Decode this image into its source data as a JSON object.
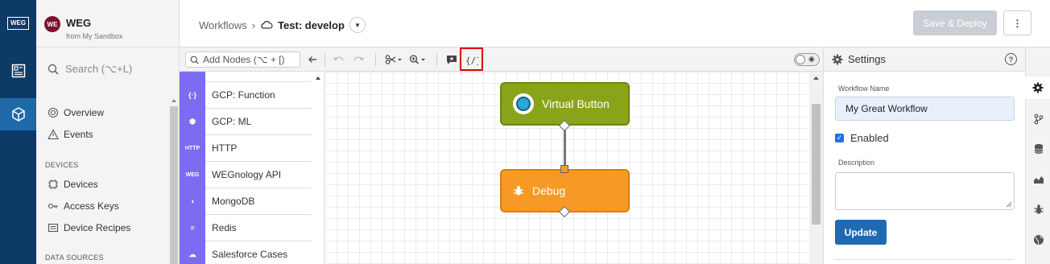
{
  "rail": {
    "logo": "WEG",
    "items": [
      {
        "icon": "dashboard-icon"
      },
      {
        "icon": "cube-icon",
        "active": true
      }
    ]
  },
  "sidebar": {
    "app_avatar": "WE",
    "app_name": "WEG",
    "app_sub": "from My Sandbox",
    "search_placeholder": "Search (⌥+L)",
    "items": [
      {
        "label": "Overview",
        "icon": "overview-icon"
      },
      {
        "label": "Events",
        "icon": "events-icon"
      }
    ],
    "section_devices": "DEVICES",
    "device_items": [
      {
        "label": "Devices",
        "icon": "chip-icon"
      },
      {
        "label": "Access Keys",
        "icon": "key-icon"
      },
      {
        "label": "Device Recipes",
        "icon": "recipe-icon"
      }
    ],
    "section_data": "DATA SOURCES"
  },
  "header": {
    "crumb_root": "Workflows",
    "crumb_sep": "›",
    "crumb_current": "Test: develop",
    "save_label": "Save & Deploy",
    "more_label": "⋮"
  },
  "toolbar": {
    "add_nodes_placeholder": "Add Nodes (⌥ + [)"
  },
  "palette": {
    "items": [
      {
        "label": "GCP: Function",
        "icon_text": "{·}"
      },
      {
        "label": "GCP: ML",
        "icon_text": "⬢"
      },
      {
        "label": "HTTP",
        "icon_text": "HTTP"
      },
      {
        "label": "WEGnology API",
        "icon_text": "WEG"
      },
      {
        "label": "MongoDB",
        "icon_text": "◖"
      },
      {
        "label": "Redis",
        "icon_text": "≡"
      },
      {
        "label": "Salesforce Cases",
        "icon_text": "☁"
      }
    ]
  },
  "canvas": {
    "nodes": [
      {
        "label": "Virtual Button",
        "color": "#8aa41a"
      },
      {
        "label": "Debug",
        "color": "#f79a25"
      }
    ]
  },
  "settings": {
    "title": "Settings",
    "name_label": "Workflow Name",
    "name_value": "My Great Workflow",
    "enabled_label": "Enabled",
    "description_label": "Description",
    "update_label": "Update"
  },
  "tabrail": {
    "tabs": [
      "gear-icon",
      "branch-icon",
      "database-icon",
      "chart-icon",
      "bug-icon",
      "globe-icon"
    ]
  }
}
